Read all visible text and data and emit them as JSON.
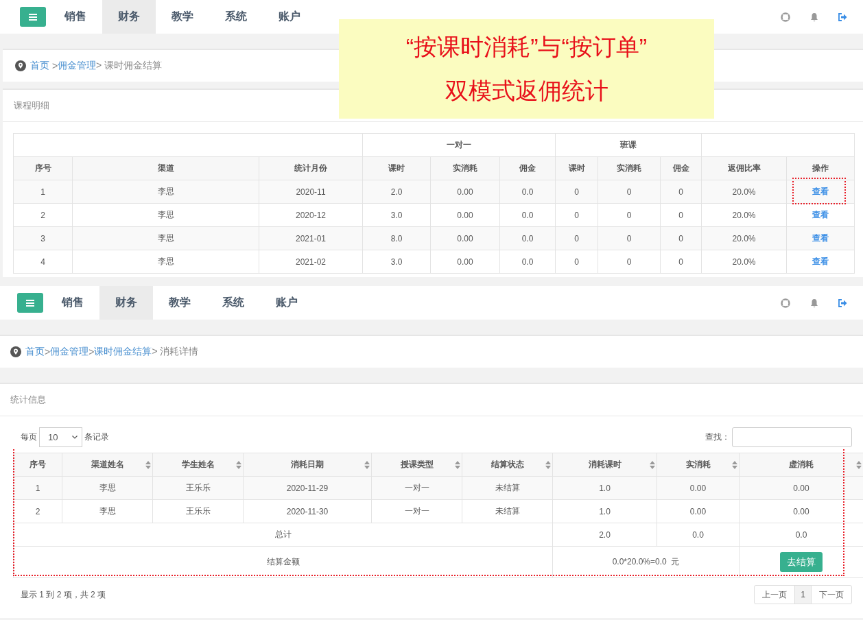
{
  "top_screen": {
    "nav": {
      "tabs": [
        {
          "label": "销售",
          "selected": false
        },
        {
          "label": "财务",
          "selected": true
        },
        {
          "label": "教学",
          "selected": false
        },
        {
          "label": "系统",
          "selected": false
        },
        {
          "label": "账户",
          "selected": false
        }
      ]
    },
    "breadcrumb": [
      {
        "text": "首页",
        "kind": "link"
      },
      {
        "text": " >",
        "kind": "sep"
      },
      {
        "text": "佣金管理",
        "kind": "link"
      },
      {
        "text": "> 课时佣金结算",
        "kind": "current"
      }
    ],
    "panel_title": "课程明细",
    "table": {
      "column_groups": [
        {
          "columns": [
            "序号",
            "渠道",
            "统计月份"
          ]
        },
        {
          "label": "一对一",
          "columns": [
            "课时",
            "实消耗",
            "佣金"
          ]
        },
        {
          "label": "班课",
          "columns": [
            "课时",
            "实消耗",
            "佣金"
          ]
        },
        {
          "columns": [
            "返佣比率",
            "操作"
          ]
        }
      ],
      "rows": [
        {
          "cells": [
            "1",
            "李思",
            "2020-11",
            "2.0",
            "0.00",
            "0.0",
            "0",
            "0",
            "0",
            "20.0%"
          ],
          "action": "查看",
          "highlighted": true
        },
        {
          "cells": [
            "2",
            "李思",
            "2020-12",
            "3.0",
            "0.00",
            "0.0",
            "0",
            "0",
            "0",
            "20.0%"
          ],
          "action": "查看",
          "highlighted": false
        },
        {
          "cells": [
            "3",
            "李思",
            "2021-01",
            "8.0",
            "0.00",
            "0.0",
            "0",
            "0",
            "0",
            "20.0%"
          ],
          "action": "查看",
          "highlighted": false
        },
        {
          "cells": [
            "4",
            "李思",
            "2021-02",
            "3.0",
            "0.00",
            "0.0",
            "0",
            "0",
            "0",
            "20.0%"
          ],
          "action": "查看",
          "highlighted": false
        }
      ]
    }
  },
  "bottom_screen": {
    "nav": {
      "tabs": [
        {
          "label": "销售",
          "selected": false
        },
        {
          "label": "财务",
          "selected": true
        },
        {
          "label": "教学",
          "selected": false
        },
        {
          "label": "系统",
          "selected": false
        },
        {
          "label": "账户",
          "selected": false
        }
      ]
    },
    "breadcrumb": [
      {
        "text": "首页",
        "kind": "link"
      },
      {
        "text": ">",
        "kind": "sep"
      },
      {
        "text": "佣金管理",
        "kind": "link"
      },
      {
        "text": ">",
        "kind": "sep"
      },
      {
        "text": "课时佣金结算",
        "kind": "link"
      },
      {
        "text": "> 消耗详情",
        "kind": "current"
      }
    ],
    "panel_title": "统计信息",
    "length_control": {
      "before": "每页",
      "value": "10",
      "after": "条记录"
    },
    "search": {
      "label": "查找："
    },
    "table": {
      "highlighted": true,
      "columns": [
        {
          "label": "序号",
          "sortable": false
        },
        {
          "label": "渠道姓名",
          "sortable": true
        },
        {
          "label": "学生姓名",
          "sortable": true
        },
        {
          "label": "消耗日期",
          "sortable": true
        },
        {
          "label": "授课类型",
          "sortable": true
        },
        {
          "label": "结算状态",
          "sortable": true
        },
        {
          "label": "消耗课时",
          "sortable": true
        },
        {
          "label": "实消耗",
          "sortable": true
        },
        {
          "label": "虚消耗",
          "sortable": true
        }
      ],
      "rows": [
        [
          "1",
          "李思",
          "王乐乐",
          "2020-11-29",
          "一对一",
          "未结算",
          "1.0",
          "0.00",
          "0.00"
        ],
        [
          "2",
          "李思",
          "王乐乐",
          "2020-11-30",
          "一对一",
          "未结算",
          "1.0",
          "0.00",
          "0.00"
        ]
      ],
      "total": {
        "label": "总计",
        "values": [
          "2.0",
          "0.0",
          "0.0"
        ]
      },
      "settlement": {
        "label": "结算金额",
        "formula": "0.0*20.0%=0.0  元",
        "button": "去结算"
      }
    },
    "info": "显示 1 到 2 项，共 2 项",
    "pagination": [
      {
        "label": "上一页",
        "kind": "prev",
        "selected": false
      },
      {
        "label": "1",
        "kind": "page",
        "selected": true
      },
      {
        "label": "下一页",
        "kind": "next",
        "selected": false
      }
    ]
  },
  "note": {
    "lines": [
      "“按课时消耗”与“按订单”",
      "双模式返佣统计"
    ]
  }
}
